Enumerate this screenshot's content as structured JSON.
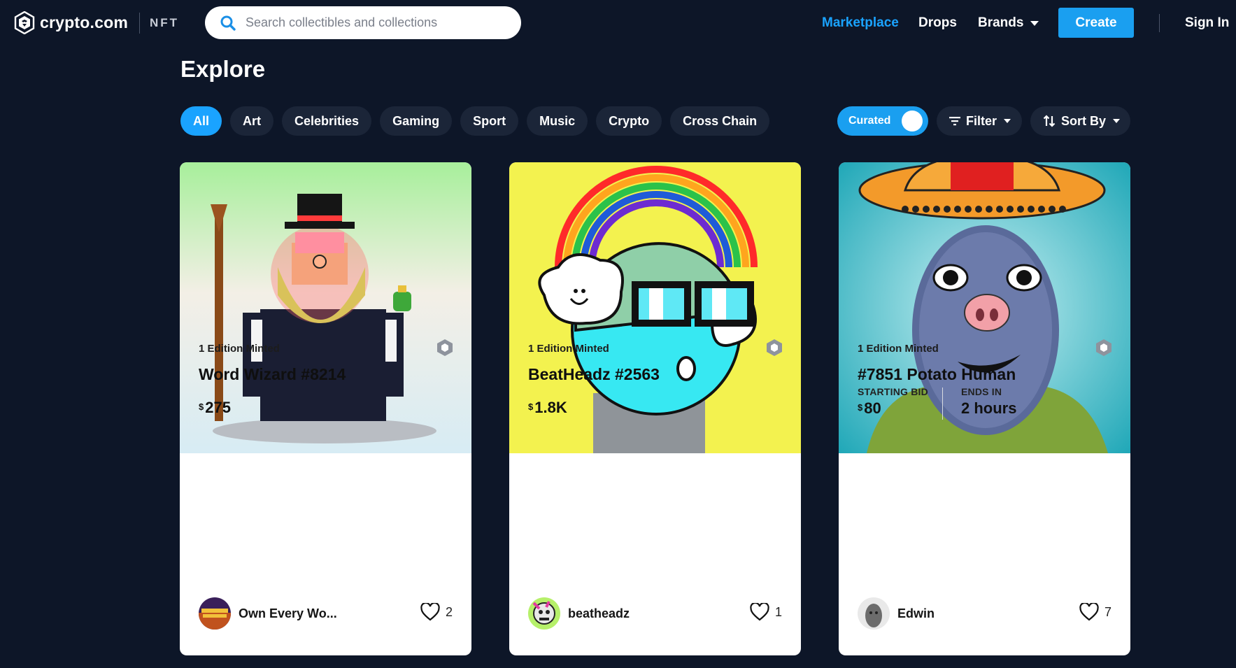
{
  "header": {
    "logo_text": "crypto.com",
    "logo_sub": "NFT",
    "search_placeholder": "Search collectibles and collections",
    "nav": {
      "marketplace": "Marketplace",
      "drops": "Drops",
      "brands": "Brands",
      "create": "Create",
      "sign_in": "Sign In"
    },
    "active_color": "#1aa3ff"
  },
  "explore": {
    "title": "Explore",
    "categories": [
      "All",
      "Art",
      "Celebrities",
      "Gaming",
      "Sport",
      "Music",
      "Crypto",
      "Cross Chain"
    ],
    "active_category": "All",
    "curated_label": "Curated",
    "curated_on": true,
    "filter_label": "Filter",
    "sort_label": "Sort By"
  },
  "cards": [
    {
      "edition": "1 Edition Minted",
      "title": "Word Wizard #8214",
      "currency": "$",
      "price": "275",
      "owner": "Own Every Wo...",
      "likes": "2"
    },
    {
      "edition": "1 Edition Minted",
      "title": "BeatHeadz #2563",
      "currency": "$",
      "price": "1.8K",
      "owner": "beatheadz",
      "likes": "1"
    },
    {
      "edition": "1 Edition Minted",
      "title": "#7851 Potato Human",
      "bid_label": "STARTING BID",
      "currency": "$",
      "price": "80",
      "ends_label": "ENDS IN",
      "ends_value": "2 hours",
      "owner": "Edwin",
      "likes": "7"
    }
  ]
}
